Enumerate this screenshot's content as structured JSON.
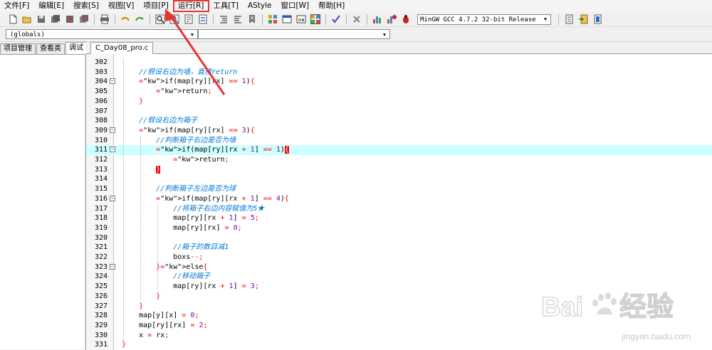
{
  "menu": [
    {
      "label": "文件[F]"
    },
    {
      "label": "编辑[E]"
    },
    {
      "label": "搜索[S]"
    },
    {
      "label": "视图[V]"
    },
    {
      "label": "项目[P]"
    },
    {
      "label": "运行[R]",
      "highlighted": true
    },
    {
      "label": "工具[T]"
    },
    {
      "label": "AStyle"
    },
    {
      "label": "窗口[W]"
    },
    {
      "label": "帮助[H]"
    }
  ],
  "toolbar": {
    "compiler_selected": "MinGW GCC 4.7.2 32-bit Release"
  },
  "scope": {
    "globals_value": "(globals)",
    "symbol_value": ""
  },
  "left_panel": {
    "tabs": [
      "项目管理",
      "查看类",
      "调试"
    ],
    "active_tab": "调试"
  },
  "editor": {
    "file_tab": "C_Day08_pro.c",
    "current_line": 311,
    "lines": [
      {
        "n": "302",
        "code": ""
      },
      {
        "n": "303",
        "code": "    //假设右边为墙，直接return"
      },
      {
        "n": "304",
        "code": "    if(map[ry][rx] == 1){",
        "fold": true
      },
      {
        "n": "305",
        "code": "        return;"
      },
      {
        "n": "306",
        "code": "    }"
      },
      {
        "n": "307",
        "code": ""
      },
      {
        "n": "308",
        "code": "    //假设右边为箱子"
      },
      {
        "n": "309",
        "code": "    if(map[ry][rx] == 3){",
        "fold": true
      },
      {
        "n": "310",
        "code": "        //判断箱子右边是否为墙"
      },
      {
        "n": "311",
        "code": "        if(map[ry][rx + 1] == 1){",
        "fold": true
      },
      {
        "n": "312",
        "code": "            return;"
      },
      {
        "n": "313",
        "code": "        }"
      },
      {
        "n": "314",
        "code": ""
      },
      {
        "n": "315",
        "code": "        //判断箱子左边是否为球"
      },
      {
        "n": "316",
        "code": "        if(map[ry][rx + 1] == 4){",
        "fold": true
      },
      {
        "n": "317",
        "code": "            //将箱子右边内容赋值为5★"
      },
      {
        "n": "318",
        "code": "            map[ry][rx + 1] = 5;"
      },
      {
        "n": "319",
        "code": "            map[ry][rx] = 0;"
      },
      {
        "n": "320",
        "code": ""
      },
      {
        "n": "321",
        "code": "            //箱子的数目减1"
      },
      {
        "n": "322",
        "code": "            boxs--;"
      },
      {
        "n": "323",
        "code": "        }else{",
        "fold": true
      },
      {
        "n": "324",
        "code": "            //移动箱子"
      },
      {
        "n": "325",
        "code": "            map[ry][rx + 1] = 3;"
      },
      {
        "n": "326",
        "code": "        }"
      },
      {
        "n": "327",
        "code": "    }"
      },
      {
        "n": "328",
        "code": "    map[y][x] = 0;"
      },
      {
        "n": "329",
        "code": "    map[ry][rx] = 2;"
      },
      {
        "n": "330",
        "code": "    x = rx;"
      },
      {
        "n": "331",
        "code": "}"
      }
    ]
  },
  "watermark": {
    "text": "jingyan.baidu.com",
    "logo": "Baidu 经验"
  },
  "colors": {
    "annotation_red": "#e8342c",
    "current_line": "#ccffff",
    "comment": "#0078d7",
    "number": "#7d00c2",
    "operator": "#ff0000"
  }
}
